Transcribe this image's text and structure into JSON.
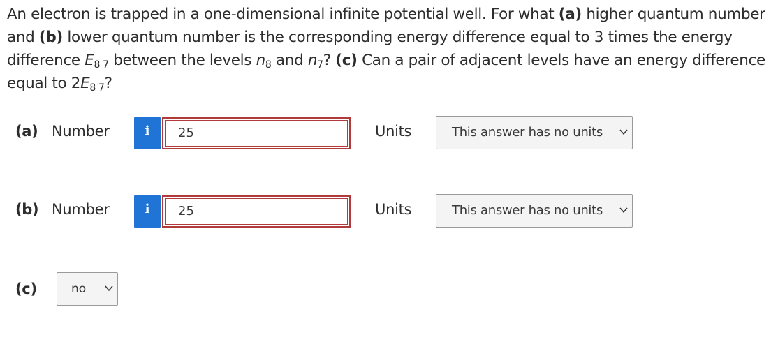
{
  "question": {
    "t1": "An electron is trapped in a one-dimensional infinite potential well. For what ",
    "a_tag": "(a)",
    "t2": " higher quantum number and ",
    "b_tag": "(b)",
    "t3": " lower quantum number is the corresponding energy difference equal to 3 times the energy difference ",
    "E": "E",
    "sub87": "8 7",
    "t4": " between the levels ",
    "n": "n",
    "sub8": "8",
    "t5": " and ",
    "n2": "n",
    "sub7": "7",
    "t6": "? ",
    "c_tag": "(c)",
    "t7": " Can a pair of adjacent levels have an energy difference equal to 2",
    "E2": "E",
    "sub87b": "8 7",
    "t8": "?"
  },
  "part_a": {
    "label": "(a)",
    "number_label": "Number",
    "info_icon": "i",
    "value": "25",
    "units_label": "Units",
    "units_selected": "This answer has no units"
  },
  "part_b": {
    "label": "(b)",
    "number_label": "Number",
    "info_icon": "i",
    "value": "25",
    "units_label": "Units",
    "units_selected": "This answer has no units"
  },
  "part_c": {
    "label": "(c)",
    "selected": "no"
  },
  "colors": {
    "info_button": "#1f74d6",
    "error_border": "#b13b3b",
    "select_bg": "#f4f4f4"
  }
}
